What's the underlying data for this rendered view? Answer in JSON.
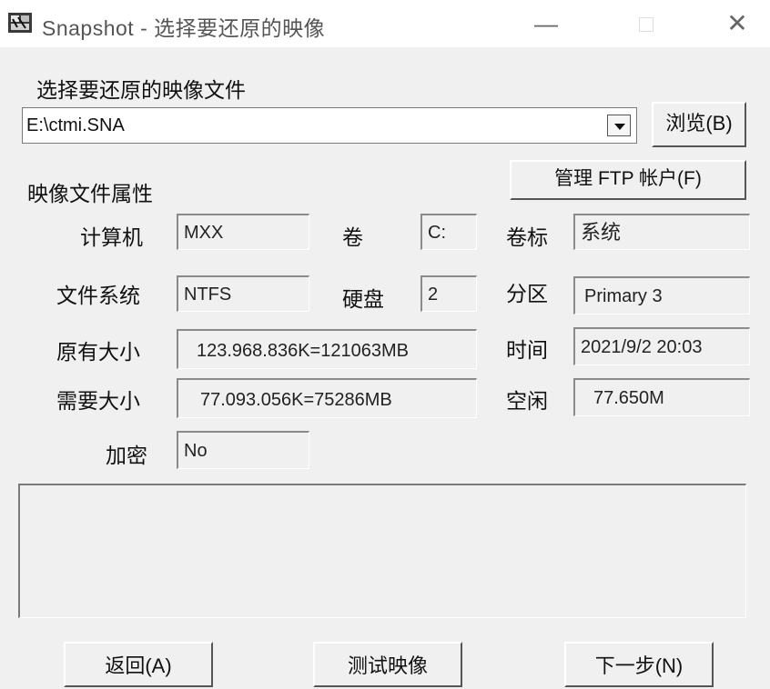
{
  "window": {
    "title": "Snapshot - 选择要还原的映像",
    "minimize_glyph": "—",
    "close_glyph": "✕"
  },
  "image_file": {
    "section_label": "选择要还原的映像文件",
    "path": "E:\\ctmi.SNA",
    "browse_label": "浏览(B)"
  },
  "properties": {
    "section_label": "映像文件属性",
    "ftp_button_label": "管理 FTP 帐户(F)",
    "computer": {
      "label": "计算机",
      "value": "MXX"
    },
    "volume": {
      "label": "卷",
      "value": "C:"
    },
    "volume_label": {
      "label": "卷标",
      "value": "系统"
    },
    "file_system": {
      "label": "文件系统",
      "value": "NTFS"
    },
    "disk": {
      "label": "硬盘",
      "value": "2"
    },
    "partition": {
      "label": "分区",
      "value": "Primary 3"
    },
    "original_size": {
      "label": "原有大小",
      "value": "123.968.836K=121063MB"
    },
    "time": {
      "label": "时间",
      "value": "2021/9/2 20:03"
    },
    "required_size": {
      "label": "需要大小",
      "value": "77.093.056K=75286MB"
    },
    "free": {
      "label": "空闲",
      "value": "77.650M"
    },
    "encryption": {
      "label": "加密",
      "value": "No"
    }
  },
  "footer": {
    "back_label": "返回(A)",
    "test_label": "测试映像",
    "next_label": "下一步(N)"
  },
  "icons": {
    "app": "snapshot-app-icon",
    "dropdown": "chevron-down-icon"
  }
}
